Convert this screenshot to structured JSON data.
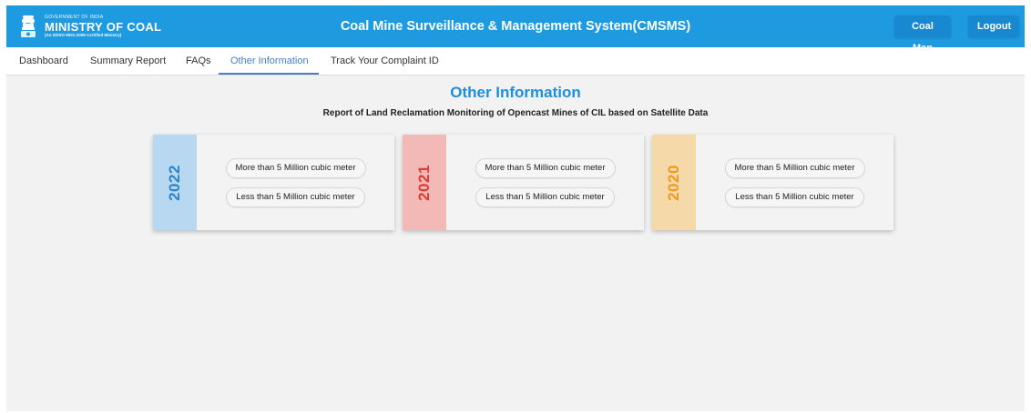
{
  "header": {
    "logo": {
      "gov_text": "GOVERNMENT OF INDIA",
      "ministry_text": "MINISTRY OF COAL",
      "cert_text": "(An IS/ISO 9001:2008 Certified Ministry)"
    },
    "title": "Coal Mine Surveillance & Management System(CMSMS)",
    "buttons": {
      "coal_map": "Coal Map",
      "logout": "Logout"
    },
    "colors": {
      "header_bg": "#1e9ae0",
      "button_bg": "#1889d0"
    }
  },
  "nav": {
    "items": [
      {
        "label": "Dashboard"
      },
      {
        "label": "Summary Report"
      },
      {
        "label": "FAQs"
      },
      {
        "label": "Other Information"
      },
      {
        "label": "Track Your Complaint ID"
      }
    ],
    "active": "Other Information"
  },
  "main": {
    "title": "Other Information",
    "subtitle": "Report of Land Reclamation Monitoring of Opencast Mines of CIL based on Satellite Data",
    "cards": [
      {
        "year": "2022",
        "accent": "#2a86cc",
        "strip_color": "#b7d8f0",
        "options": [
          "More than 5 Million cubic meter",
          "Less than 5 Million cubic meter"
        ]
      },
      {
        "year": "2021",
        "accent": "#e03a34",
        "strip_color": "#f2b9b6",
        "options": [
          "More than 5 Million cubic meter",
          "Less than 5 Million cubic meter"
        ]
      },
      {
        "year": "2020",
        "accent": "#ef9a1c",
        "strip_color": "#f6d9a9",
        "options": [
          "More than 5 Million cubic meter",
          "Less than 5 Million cubic meter"
        ]
      }
    ]
  }
}
